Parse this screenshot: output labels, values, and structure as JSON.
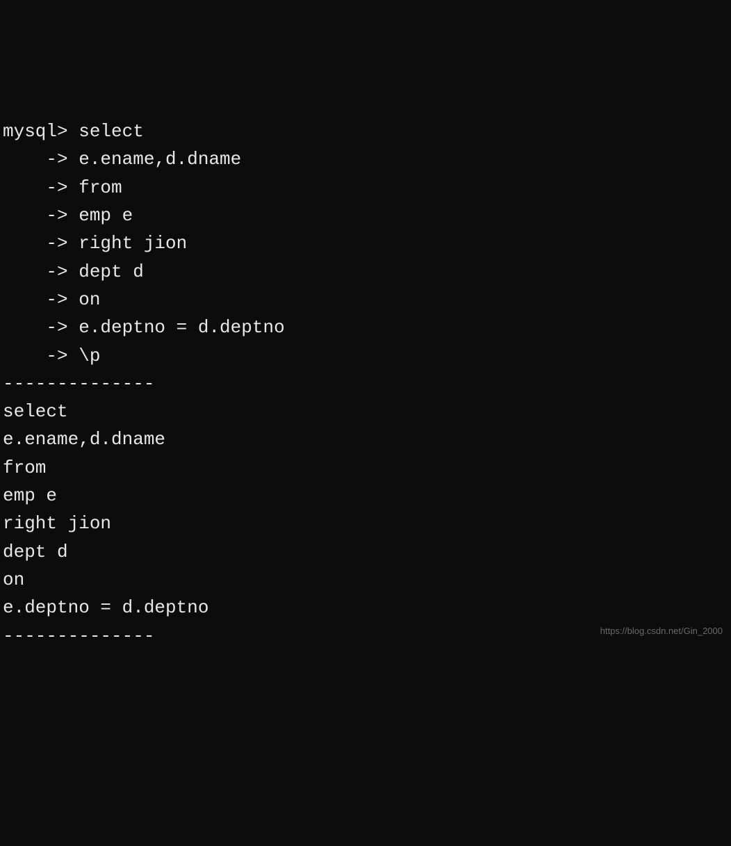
{
  "terminal": {
    "prompt": "mysql> ",
    "continuation": "    -> ",
    "lines": [
      "select",
      "e.ename,d.dname",
      "from",
      "emp e",
      "right jion",
      "dept d",
      "on",
      "e.deptno = d.deptno",
      "\\p"
    ],
    "separator": "--------------",
    "output": [
      "select",
      "e.ename,d.dname",
      "from",
      "emp e",
      "right jion",
      "dept d",
      "on",
      "e.deptno = d.deptno"
    ]
  },
  "watermark": "https://blog.csdn.net/Gin_2000"
}
